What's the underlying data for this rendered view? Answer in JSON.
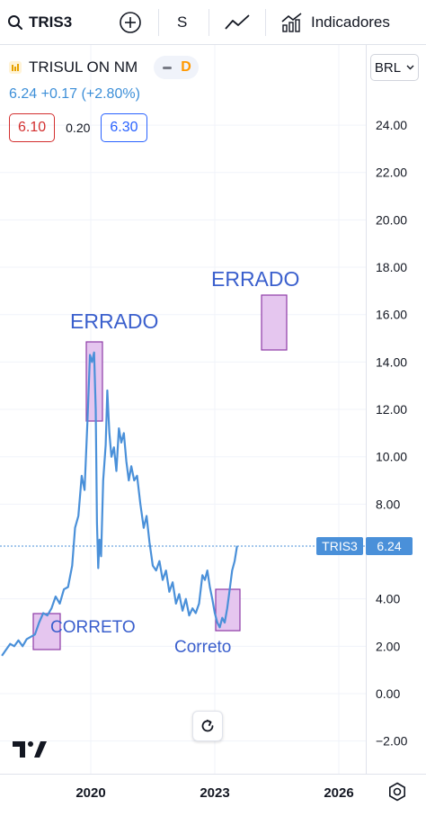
{
  "toolbar": {
    "symbol": "TRIS3",
    "interval": "S",
    "indicators_label": "Indicadores"
  },
  "legend": {
    "name": "TRISUL ON NM",
    "badge": "D",
    "price": "6.24",
    "change": "+0.17",
    "change_pct": "(+2.80%)",
    "bid": "6.10",
    "spread": "0.20",
    "ask": "6.30"
  },
  "currency": "BRL",
  "price_tag": {
    "symbol": "TRIS3",
    "value": "6.24"
  },
  "annotations": {
    "errado_1": "ERRADO",
    "errado_2": "ERRADO",
    "correto_1": "CORRETO",
    "correto_2": "Correto"
  },
  "colors": {
    "line": "#4a90d9",
    "annotation_text": "#3a5fcd",
    "box_fill": "#e5c6ef",
    "box_stroke": "#8e3aa6",
    "tag_bg": "#4a90d9"
  },
  "chart_data": {
    "type": "line",
    "series": [
      {
        "name": "TRIS3",
        "points": [
          [
            2017.85,
            1.6
          ],
          [
            2017.95,
            1.85
          ],
          [
            2018.05,
            2.1
          ],
          [
            2018.15,
            2.0
          ],
          [
            2018.25,
            2.25
          ],
          [
            2018.35,
            2.0
          ],
          [
            2018.45,
            2.3
          ],
          [
            2018.55,
            2.4
          ],
          [
            2018.65,
            2.5
          ],
          [
            2018.75,
            3.0
          ],
          [
            2018.85,
            3.4
          ],
          [
            2018.95,
            3.3
          ],
          [
            2019.05,
            3.6
          ],
          [
            2019.15,
            4.1
          ],
          [
            2019.25,
            3.8
          ],
          [
            2019.35,
            4.4
          ],
          [
            2019.45,
            4.5
          ],
          [
            2019.55,
            5.4
          ],
          [
            2019.62,
            7.0
          ],
          [
            2019.7,
            7.5
          ],
          [
            2019.78,
            9.2
          ],
          [
            2019.85,
            8.6
          ],
          [
            2019.92,
            11.5
          ],
          [
            2019.98,
            14.3
          ],
          [
            2020.03,
            14.0
          ],
          [
            2020.08,
            14.4
          ],
          [
            2020.12,
            12.0
          ],
          [
            2020.15,
            7.2
          ],
          [
            2020.18,
            5.3
          ],
          [
            2020.21,
            6.5
          ],
          [
            2020.25,
            5.8
          ],
          [
            2020.3,
            9.0
          ],
          [
            2020.36,
            10.5
          ],
          [
            2020.4,
            12.8
          ],
          [
            2020.45,
            11.0
          ],
          [
            2020.5,
            10.0
          ],
          [
            2020.56,
            10.4
          ],
          [
            2020.62,
            9.4
          ],
          [
            2020.68,
            11.2
          ],
          [
            2020.74,
            10.6
          ],
          [
            2020.8,
            11.0
          ],
          [
            2020.86,
            9.8
          ],
          [
            2020.92,
            9.0
          ],
          [
            2020.98,
            9.6
          ],
          [
            2021.05,
            9.0
          ],
          [
            2021.12,
            9.2
          ],
          [
            2021.2,
            8.0
          ],
          [
            2021.28,
            7.0
          ],
          [
            2021.35,
            7.5
          ],
          [
            2021.42,
            6.4
          ],
          [
            2021.5,
            5.4
          ],
          [
            2021.58,
            5.2
          ],
          [
            2021.66,
            5.6
          ],
          [
            2021.74,
            4.8
          ],
          [
            2021.82,
            5.2
          ],
          [
            2021.9,
            4.3
          ],
          [
            2021.98,
            4.7
          ],
          [
            2022.06,
            3.8
          ],
          [
            2022.14,
            4.2
          ],
          [
            2022.22,
            3.5
          ],
          [
            2022.3,
            4.0
          ],
          [
            2022.38,
            3.3
          ],
          [
            2022.46,
            3.6
          ],
          [
            2022.54,
            3.4
          ],
          [
            2022.62,
            3.8
          ],
          [
            2022.7,
            5.0
          ],
          [
            2022.76,
            4.8
          ],
          [
            2022.82,
            5.2
          ],
          [
            2022.88,
            4.5
          ],
          [
            2022.94,
            4.0
          ],
          [
            2023.0,
            3.4
          ],
          [
            2023.06,
            3.0
          ],
          [
            2023.12,
            2.8
          ],
          [
            2023.18,
            3.2
          ],
          [
            2023.24,
            3.0
          ],
          [
            2023.3,
            3.6
          ],
          [
            2023.36,
            4.4
          ],
          [
            2023.42,
            5.2
          ],
          [
            2023.48,
            5.6
          ],
          [
            2023.54,
            6.24
          ]
        ]
      }
    ],
    "x_ticks": [
      "2020",
      "2023",
      "2026"
    ],
    "y_ticks": [
      "24.00",
      "22.00",
      "20.00",
      "18.00",
      "16.00",
      "14.00",
      "12.00",
      "10.00",
      "8.00",
      "4.00",
      "2.00",
      "0.00",
      "−2.00"
    ],
    "ylim": [
      -2.5,
      25
    ],
    "last_value": 6.24
  }
}
